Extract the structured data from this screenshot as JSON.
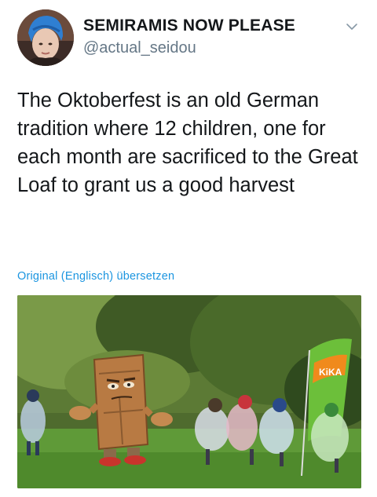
{
  "tweet": {
    "author": {
      "display_name": "SEMIRAMIS NOW PLEASE",
      "handle": "@actual_seidou"
    },
    "text": "The Oktoberfest is an old German tradition where 12 children, one for each month are sacrificed to the Great Loaf to grant us a good harvest",
    "translate_link": "Original (Englisch) übersetzen"
  },
  "photo": {
    "banner_text": "KiKA"
  },
  "colors": {
    "text": "#14171a",
    "handle": "#657786",
    "link": "#1b95e0"
  },
  "icons": {
    "menu": "chevron-down-icon"
  }
}
